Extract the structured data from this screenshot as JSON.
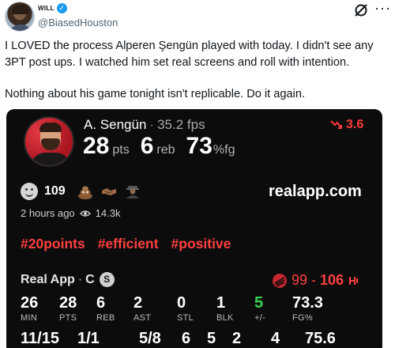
{
  "tweet": {
    "display_name": "WILL",
    "handle": "@BiasedHouston",
    "paragraphs": [
      "I LOVED the process Alperen Şengün played with today. I didn't see any 3PT post ups. I watched him set real screens and roll with intention.",
      "Nothing about his game tonight isn't replicable. Do it again."
    ],
    "icons": [
      "verified-badge-icon",
      "grok-icon",
      "more-icon"
    ]
  },
  "card": {
    "player_name": "A. Sengün",
    "fps": "35.2 fps",
    "trend_value": "3.6",
    "points": "28",
    "points_unit": "pts",
    "rebounds": "6",
    "rebounds_unit": "reb",
    "fg_pct": "73",
    "fg_unit": "%fg",
    "reaction_count": "109",
    "site": "realapp.com",
    "time_ago": "2 hours ago",
    "views": "14.3k",
    "tags": [
      "#20points",
      "#efficient",
      "#positive"
    ],
    "app_name": "Real App",
    "position": "C",
    "badge": "S",
    "score_left": "99",
    "score_sep": "-",
    "score_right": "106",
    "stats": [
      {
        "value": "26",
        "label": "MIN"
      },
      {
        "value": "28",
        "label": "PTS"
      },
      {
        "value": "6",
        "label": "REB"
      },
      {
        "value": "2",
        "label": "AST"
      },
      {
        "value": "0",
        "label": "STL"
      },
      {
        "value": "1",
        "label": "BLK"
      },
      {
        "value": "5",
        "label": "+/-"
      },
      {
        "value": "73.3",
        "label": "FG%"
      }
    ],
    "shooting_row": [
      "11/15",
      "1/1",
      "5/8",
      "6",
      "5",
      "2",
      "4",
      "75.6"
    ],
    "colors": {
      "background": "#0c0c0c",
      "accent_red": "#ff4040",
      "positive_green": "#39d353"
    }
  }
}
